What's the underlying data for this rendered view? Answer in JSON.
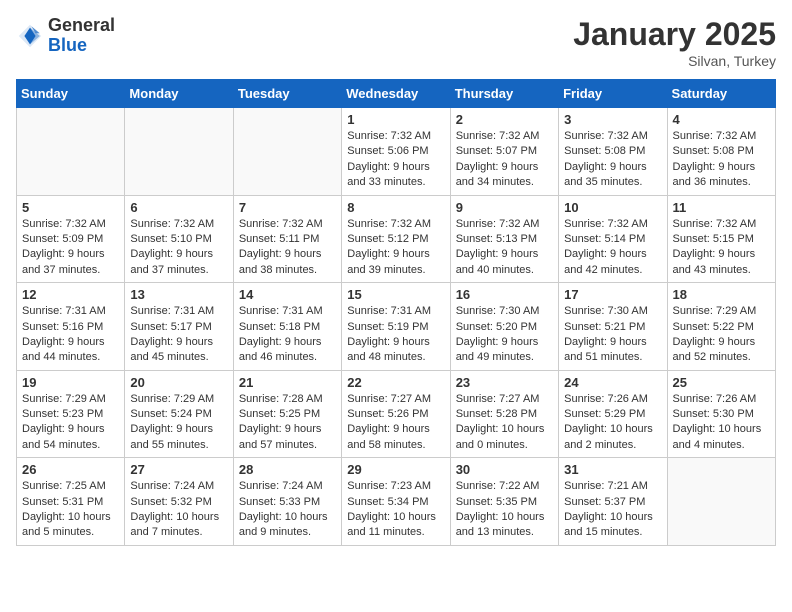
{
  "header": {
    "logo_general": "General",
    "logo_blue": "Blue",
    "month_title": "January 2025",
    "location": "Silvan, Turkey"
  },
  "weekdays": [
    "Sunday",
    "Monday",
    "Tuesday",
    "Wednesday",
    "Thursday",
    "Friday",
    "Saturday"
  ],
  "weeks": [
    [
      {
        "day": "",
        "content": ""
      },
      {
        "day": "",
        "content": ""
      },
      {
        "day": "",
        "content": ""
      },
      {
        "day": "1",
        "content": "Sunrise: 7:32 AM\nSunset: 5:06 PM\nDaylight: 9 hours\nand 33 minutes."
      },
      {
        "day": "2",
        "content": "Sunrise: 7:32 AM\nSunset: 5:07 PM\nDaylight: 9 hours\nand 34 minutes."
      },
      {
        "day": "3",
        "content": "Sunrise: 7:32 AM\nSunset: 5:08 PM\nDaylight: 9 hours\nand 35 minutes."
      },
      {
        "day": "4",
        "content": "Sunrise: 7:32 AM\nSunset: 5:08 PM\nDaylight: 9 hours\nand 36 minutes."
      }
    ],
    [
      {
        "day": "5",
        "content": "Sunrise: 7:32 AM\nSunset: 5:09 PM\nDaylight: 9 hours\nand 37 minutes."
      },
      {
        "day": "6",
        "content": "Sunrise: 7:32 AM\nSunset: 5:10 PM\nDaylight: 9 hours\nand 37 minutes."
      },
      {
        "day": "7",
        "content": "Sunrise: 7:32 AM\nSunset: 5:11 PM\nDaylight: 9 hours\nand 38 minutes."
      },
      {
        "day": "8",
        "content": "Sunrise: 7:32 AM\nSunset: 5:12 PM\nDaylight: 9 hours\nand 39 minutes."
      },
      {
        "day": "9",
        "content": "Sunrise: 7:32 AM\nSunset: 5:13 PM\nDaylight: 9 hours\nand 40 minutes."
      },
      {
        "day": "10",
        "content": "Sunrise: 7:32 AM\nSunset: 5:14 PM\nDaylight: 9 hours\nand 42 minutes."
      },
      {
        "day": "11",
        "content": "Sunrise: 7:32 AM\nSunset: 5:15 PM\nDaylight: 9 hours\nand 43 minutes."
      }
    ],
    [
      {
        "day": "12",
        "content": "Sunrise: 7:31 AM\nSunset: 5:16 PM\nDaylight: 9 hours\nand 44 minutes."
      },
      {
        "day": "13",
        "content": "Sunrise: 7:31 AM\nSunset: 5:17 PM\nDaylight: 9 hours\nand 45 minutes."
      },
      {
        "day": "14",
        "content": "Sunrise: 7:31 AM\nSunset: 5:18 PM\nDaylight: 9 hours\nand 46 minutes."
      },
      {
        "day": "15",
        "content": "Sunrise: 7:31 AM\nSunset: 5:19 PM\nDaylight: 9 hours\nand 48 minutes."
      },
      {
        "day": "16",
        "content": "Sunrise: 7:30 AM\nSunset: 5:20 PM\nDaylight: 9 hours\nand 49 minutes."
      },
      {
        "day": "17",
        "content": "Sunrise: 7:30 AM\nSunset: 5:21 PM\nDaylight: 9 hours\nand 51 minutes."
      },
      {
        "day": "18",
        "content": "Sunrise: 7:29 AM\nSunset: 5:22 PM\nDaylight: 9 hours\nand 52 minutes."
      }
    ],
    [
      {
        "day": "19",
        "content": "Sunrise: 7:29 AM\nSunset: 5:23 PM\nDaylight: 9 hours\nand 54 minutes."
      },
      {
        "day": "20",
        "content": "Sunrise: 7:29 AM\nSunset: 5:24 PM\nDaylight: 9 hours\nand 55 minutes."
      },
      {
        "day": "21",
        "content": "Sunrise: 7:28 AM\nSunset: 5:25 PM\nDaylight: 9 hours\nand 57 minutes."
      },
      {
        "day": "22",
        "content": "Sunrise: 7:27 AM\nSunset: 5:26 PM\nDaylight: 9 hours\nand 58 minutes."
      },
      {
        "day": "23",
        "content": "Sunrise: 7:27 AM\nSunset: 5:28 PM\nDaylight: 10 hours\nand 0 minutes."
      },
      {
        "day": "24",
        "content": "Sunrise: 7:26 AM\nSunset: 5:29 PM\nDaylight: 10 hours\nand 2 minutes."
      },
      {
        "day": "25",
        "content": "Sunrise: 7:26 AM\nSunset: 5:30 PM\nDaylight: 10 hours\nand 4 minutes."
      }
    ],
    [
      {
        "day": "26",
        "content": "Sunrise: 7:25 AM\nSunset: 5:31 PM\nDaylight: 10 hours\nand 5 minutes."
      },
      {
        "day": "27",
        "content": "Sunrise: 7:24 AM\nSunset: 5:32 PM\nDaylight: 10 hours\nand 7 minutes."
      },
      {
        "day": "28",
        "content": "Sunrise: 7:24 AM\nSunset: 5:33 PM\nDaylight: 10 hours\nand 9 minutes."
      },
      {
        "day": "29",
        "content": "Sunrise: 7:23 AM\nSunset: 5:34 PM\nDaylight: 10 hours\nand 11 minutes."
      },
      {
        "day": "30",
        "content": "Sunrise: 7:22 AM\nSunset: 5:35 PM\nDaylight: 10 hours\nand 13 minutes."
      },
      {
        "day": "31",
        "content": "Sunrise: 7:21 AM\nSunset: 5:37 PM\nDaylight: 10 hours\nand 15 minutes."
      },
      {
        "day": "",
        "content": ""
      }
    ]
  ]
}
